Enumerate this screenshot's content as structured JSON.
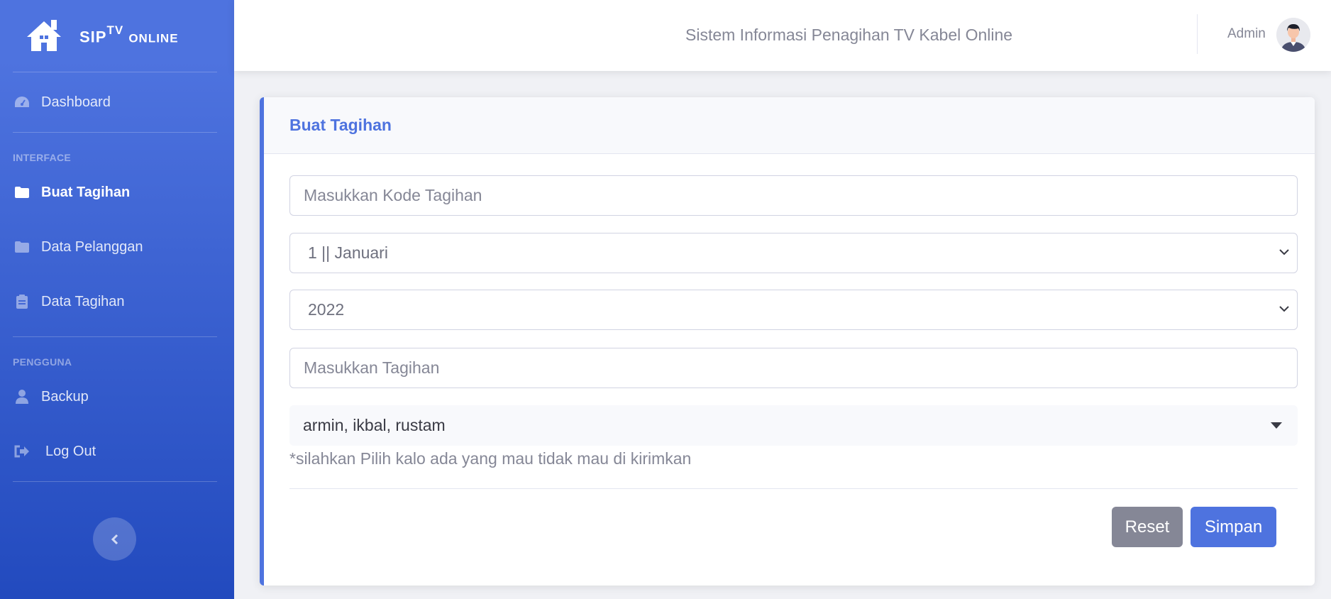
{
  "brand": {
    "name": "SIP",
    "sup": "TV",
    "suffix": "ONLINE"
  },
  "sidebar": {
    "dashboard": "Dashboard",
    "heading_interface": "INTERFACE",
    "buat_tagihan": "Buat Tagihan",
    "data_pelanggan": "Data Pelanggan",
    "data_tagihan": "Data Tagihan",
    "heading_pengguna": "PENGGUNA",
    "backup": "Backup",
    "logout": "Log Out"
  },
  "topbar": {
    "title": "Sistem Informasi Penagihan TV Kabel Online",
    "user": "Admin"
  },
  "form": {
    "title": "Buat Tagihan",
    "kode_placeholder": "Masukkan Kode Tagihan",
    "bulan_selected": "1 || Januari",
    "tahun_selected": "2022",
    "tagihan_placeholder": "Masukkan Tagihan",
    "pelanggan_selected": "armin, ikbal, rustam",
    "hint": "*silahkan Pilih kalo ada yang mau tidak mau di kirimkan",
    "reset": "Reset",
    "simpan": "Simpan"
  },
  "colors": {
    "primary": "#4e73df",
    "secondary": "#858796",
    "sidebar_end": "#224abe"
  }
}
